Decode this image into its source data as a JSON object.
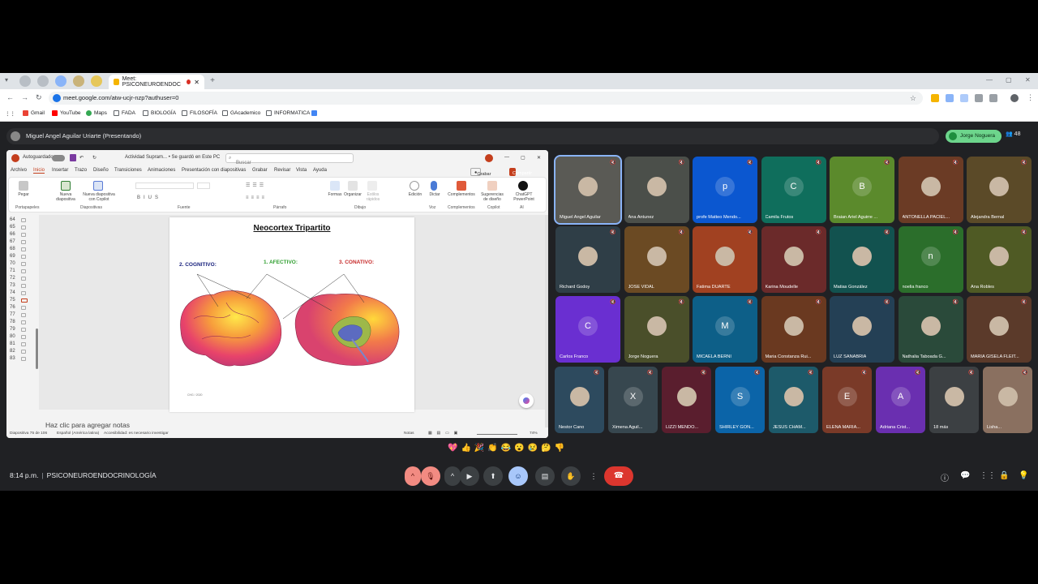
{
  "browser": {
    "tab_title": "Meet: PSICONEUROENDOC",
    "url": "meet.google.com/atw-ucjr-nzp?authuser=0",
    "bookmarks": [
      "Gmail",
      "YouTube",
      "Maps",
      "FADA",
      "BIOLOGÍA",
      "FILOSOFÍA",
      "GAcademico",
      "INFORMATICA"
    ]
  },
  "meet": {
    "presenter": "Miguel Angel Aguilar Uriarte (Presentando)",
    "pinned": "Jorge Noguera",
    "participant_count": "48",
    "time": "8:14 p.m.",
    "meeting_name": "PSICONEUROENDOCRINOLOGÍA",
    "reactions": [
      "💖",
      "👍",
      "🎉",
      "👏",
      "😂",
      "😮",
      "😢",
      "🤔",
      "👎"
    ]
  },
  "ppt": {
    "autosave": "Autoguardado",
    "doc_title": "Actividad Supram... • Se guardó en Este PC",
    "search": "Buscar",
    "menu": [
      "Archivo",
      "Inicio",
      "Insertar",
      "Trazo",
      "Diseño",
      "Transiciones",
      "Animaciones",
      "Presentación con diapositivas",
      "Grabar",
      "Revisar",
      "Vista",
      "Ayuda"
    ],
    "record": "Grabar",
    "share": "Compartir",
    "ribbon": {
      "pegar": "Pegar",
      "nueva": "Nueva diapositiva",
      "copilot": "Nueva diapositiva con Copilot",
      "formas": "Formas",
      "organizar": "Organizar",
      "estilos": "Estilos rápidos",
      "edicion": "Edición",
      "dictar": "Dictar",
      "complementos": "Complementos",
      "sugerencias": "Sugerencias de diseño",
      "chatgpt": "ChatGPT PowerPoint"
    },
    "groups": [
      "Portapapeles",
      "Diapositivas",
      "Fuente",
      "Párrafo",
      "Dibujo",
      "Voz",
      "Complementos",
      "Copilot",
      "AI"
    ],
    "thumb_numbers": [
      "64",
      "65",
      "66",
      "67",
      "68",
      "69",
      "70",
      "71",
      "72",
      "73",
      "74",
      "75",
      "76",
      "77",
      "78",
      "79",
      "80",
      "81",
      "82",
      "83"
    ],
    "slide": {
      "title": "Neocortex Tripartito",
      "l1": "2. COGNITIVO:",
      "l2": "1. AFECTIVO:",
      "l3": "3. CONATIVO:",
      "footnote": "CHG / 2020"
    },
    "notes": "Haz clic para agregar notas",
    "status": {
      "slide": "Diapositiva 75 de 106",
      "lang": "Español (América latina)",
      "access": "Accesibilidad: es necesario investigar",
      "notes": "Notas",
      "zoom": "74%"
    }
  },
  "participants": [
    {
      "name": "Miguel Angel Aguilar",
      "letter": "",
      "color": "#5a5a55"
    },
    {
      "name": "Ana Antunez",
      "letter": "",
      "color": "#4b4f4a"
    },
    {
      "name": "profe Matteo Mendo...",
      "letter": "p",
      "color": "#0b57d0"
    },
    {
      "name": "Camila Frutos",
      "letter": "C",
      "color": "#0f6e5c"
    },
    {
      "name": "Braian Ariel Aguirre ...",
      "letter": "B",
      "color": "#5b8a2c"
    },
    {
      "name": "ANTONELLA PACIEL...",
      "letter": "",
      "color": "#6b3b25"
    },
    {
      "name": "Alejandra Bernal",
      "letter": "",
      "color": "#5b4a28"
    },
    {
      "name": "Richard Godoy",
      "letter": "",
      "color": "#2f3e47"
    },
    {
      "name": "JOSE VIDAL",
      "letter": "",
      "color": "#6b4a23"
    },
    {
      "name": "Fatima DUARTE",
      "letter": "",
      "color": "#a14121"
    },
    {
      "name": "Karina Moudelle",
      "letter": "",
      "color": "#6b2a2a"
    },
    {
      "name": "Matias González",
      "letter": "",
      "color": "#12524f"
    },
    {
      "name": "noelia franco",
      "letter": "n",
      "color": "#2b6e2b"
    },
    {
      "name": "Ana Robles",
      "letter": "",
      "color": "#4f5a24"
    },
    {
      "name": "Carlos Franco",
      "letter": "C",
      "color": "#6a2fd1"
    },
    {
      "name": "Jorge Noguera",
      "letter": "",
      "color": "#4a4f2a"
    },
    {
      "name": "MICAELA BERNI",
      "letter": "M",
      "color": "#0d5f88"
    },
    {
      "name": "Maria Constanza Rui...",
      "letter": "",
      "color": "#6a3920"
    },
    {
      "name": "LUZ SANABRIA",
      "letter": "",
      "color": "#244055"
    },
    {
      "name": "Nathalia Taboada G...",
      "letter": "",
      "color": "#2a4a3a"
    },
    {
      "name": "MARIA GISELA FLEIT...",
      "letter": "",
      "color": "#5b3a2a"
    },
    {
      "name": "Nestor Cano",
      "letter": "",
      "color": "#2d4a5e"
    },
    {
      "name": "Ximena Aguil...",
      "letter": "X",
      "color": "#37474f"
    },
    {
      "name": "LIZZI MENDO...",
      "letter": "",
      "color": "#5a1e2e"
    },
    {
      "name": "SHIRLEY GON...",
      "letter": "S",
      "color": "#0b64a8"
    },
    {
      "name": "JESUS CHAM...",
      "letter": "",
      "color": "#1d5a6a"
    },
    {
      "name": "ELENA MARIA...",
      "letter": "E",
      "color": "#7a3a28"
    },
    {
      "name": "Adriana Crist...",
      "letter": "A",
      "color": "#6a2fb0"
    },
    {
      "name": "18 más",
      "letter": "",
      "color": "#3c4043"
    },
    {
      "name": "Lisha...",
      "letter": "",
      "color": "#8a7060"
    }
  ],
  "colors": {
    "cognitive": "#1a237e",
    "affective": "#2e9e2e",
    "conative": "#c62828"
  }
}
